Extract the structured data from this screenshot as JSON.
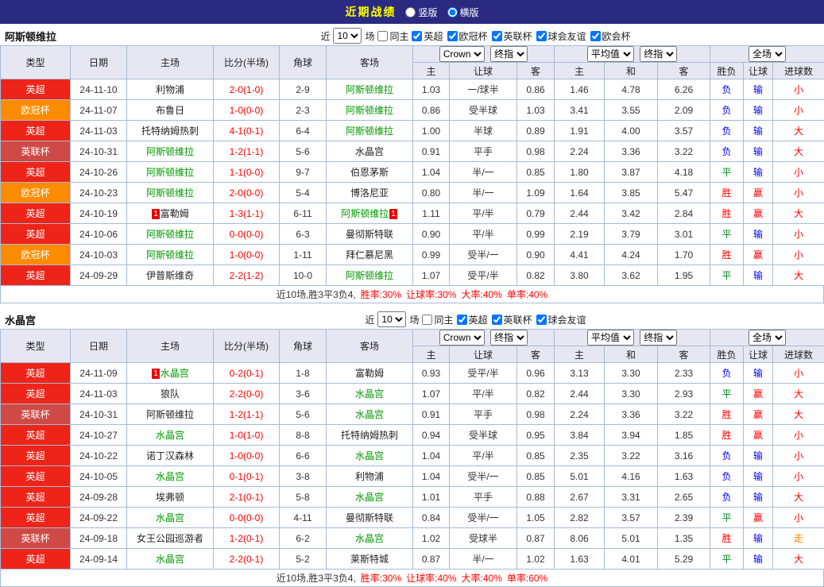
{
  "topbar": {
    "title": "近期战绩",
    "layout_options": [
      {
        "label": "竖版",
        "selected": false
      },
      {
        "label": "横版",
        "selected": true
      }
    ]
  },
  "filter": {
    "prefix": "近",
    "count": "10",
    "suffix": "场",
    "same_home": "同主"
  },
  "table_header": {
    "col_type": "类型",
    "col_date": "日期",
    "col_home": "主场",
    "col_score": "比分(半场)",
    "col_corner": "角球",
    "col_away": "客场",
    "bookmaker_option": "Crown",
    "final_option": "终指",
    "average_option": "平均值",
    "fulltime_option": "全场",
    "sub": [
      "主",
      "让球",
      "客",
      "主",
      "和",
      "客",
      "胜负",
      "让球",
      "进球数"
    ]
  },
  "league_colors": {
    "英超": "#ee2418",
    "欧冠杯": "#ff8c00",
    "英联杯": "#cf4a46"
  },
  "result_colors": {
    "胜": "#ff0000",
    "平": "#008822",
    "负": "#0000ee",
    "赢": "#ff0000",
    "输": "#0000ee",
    "大": "#ff0000",
    "小": "#ff0000",
    "走": "#ff8800"
  },
  "sections": [
    {
      "team": "阿斯顿维拉",
      "leagues": [
        "英超",
        "欧冠杯",
        "英联杯",
        "球会友谊",
        "欧会杯"
      ],
      "rows": [
        {
          "type": "英超",
          "date": "24-11-10",
          "home": {
            "name": "利物浦"
          },
          "score": "2-0(1-0)",
          "corner": "2-9",
          "away": {
            "name": "阿斯顿维拉",
            "subject": true
          },
          "odds": [
            "1.03",
            "一/球半",
            "0.86"
          ],
          "avg": [
            "1.46",
            "4.78",
            "6.26"
          ],
          "results": [
            "负",
            "输",
            "小"
          ]
        },
        {
          "type": "欧冠杯",
          "date": "24-11-07",
          "home": {
            "name": "布鲁日"
          },
          "score": "1-0(0-0)",
          "corner": "2-3",
          "away": {
            "name": "阿斯顿维拉",
            "subject": true
          },
          "odds": [
            "0.86",
            "受半球",
            "1.03"
          ],
          "avg": [
            "3.41",
            "3.55",
            "2.09"
          ],
          "results": [
            "负",
            "输",
            "小"
          ]
        },
        {
          "type": "英超",
          "date": "24-11-03",
          "home": {
            "name": "托特纳姆热刺"
          },
          "score": "4-1(0-1)",
          "corner": "6-4",
          "away": {
            "name": "阿斯顿维拉",
            "subject": true
          },
          "odds": [
            "1.00",
            "半球",
            "0.89"
          ],
          "avg": [
            "1.91",
            "4.00",
            "3.57"
          ],
          "results": [
            "负",
            "输",
            "大"
          ]
        },
        {
          "type": "英联杯",
          "date": "24-10-31",
          "home": {
            "name": "阿斯顿维拉",
            "subject": true
          },
          "score": "1-2(1-1)",
          "corner": "5-6",
          "away": {
            "name": "水晶宫"
          },
          "odds": [
            "0.91",
            "平手",
            "0.98"
          ],
          "avg": [
            "2.24",
            "3.36",
            "3.22"
          ],
          "results": [
            "负",
            "输",
            "大"
          ]
        },
        {
          "type": "英超",
          "date": "24-10-26",
          "home": {
            "name": "阿斯顿维拉",
            "subject": true
          },
          "score": "1-1(0-0)",
          "corner": "9-7",
          "away": {
            "name": "伯恩茅斯"
          },
          "odds": [
            "1.04",
            "半/一",
            "0.85"
          ],
          "avg": [
            "1.80",
            "3.87",
            "4.18"
          ],
          "results": [
            "平",
            "输",
            "小"
          ]
        },
        {
          "type": "欧冠杯",
          "date": "24-10-23",
          "home": {
            "name": "阿斯顿维拉",
            "subject": true
          },
          "score": "2-0(0-0)",
          "corner": "5-4",
          "away": {
            "name": "博洛尼亚"
          },
          "odds": [
            "0.80",
            "半/一",
            "1.09"
          ],
          "avg": [
            "1.64",
            "3.85",
            "5.47"
          ],
          "results": [
            "胜",
            "赢",
            "小"
          ]
        },
        {
          "type": "英超",
          "date": "24-10-19",
          "home": {
            "name": "富勒姆",
            "badge_pre": "1"
          },
          "score": "1-3(1-1)",
          "corner": "6-11",
          "away": {
            "name": "阿斯顿维拉",
            "subject": true,
            "badge_post": "1"
          },
          "odds": [
            "1.11",
            "平/半",
            "0.79"
          ],
          "avg": [
            "2.44",
            "3.42",
            "2.84"
          ],
          "results": [
            "胜",
            "赢",
            "大"
          ]
        },
        {
          "type": "英超",
          "date": "24-10-06",
          "home": {
            "name": "阿斯顿维拉",
            "subject": true
          },
          "score": "0-0(0-0)",
          "corner": "6-3",
          "away": {
            "name": "曼彻斯特联"
          },
          "odds": [
            "0.90",
            "平/半",
            "0.99"
          ],
          "avg": [
            "2.19",
            "3.79",
            "3.01"
          ],
          "results": [
            "平",
            "输",
            "小"
          ]
        },
        {
          "type": "欧冠杯",
          "date": "24-10-03",
          "home": {
            "name": "阿斯顿维拉",
            "subject": true
          },
          "score": "1-0(0-0)",
          "corner": "1-11",
          "away": {
            "name": "拜仁慕尼黑"
          },
          "odds": [
            "0.99",
            "受半/一",
            "0.90"
          ],
          "avg": [
            "4.41",
            "4.24",
            "1.70"
          ],
          "results": [
            "胜",
            "赢",
            "小"
          ]
        },
        {
          "type": "英超",
          "date": "24-09-29",
          "home": {
            "name": "伊普斯维奇"
          },
          "score": "2-2(1-2)",
          "corner": "10-0",
          "away": {
            "name": "阿斯顿维拉",
            "subject": true
          },
          "odds": [
            "1.07",
            "受平/半",
            "0.82"
          ],
          "avg": [
            "3.80",
            "3.62",
            "1.95"
          ],
          "results": [
            "平",
            "输",
            "大"
          ]
        }
      ],
      "summary": [
        {
          "t": "近10场,胜3平3负4,",
          "red": false
        },
        {
          "t": "胜率:30%",
          "red": true
        },
        {
          "t": "让球率:30%",
          "red": true
        },
        {
          "t": "大率:40%",
          "red": true
        },
        {
          "t": "单率:40%",
          "red": true
        }
      ]
    },
    {
      "team": "水晶宫",
      "leagues": [
        "英超",
        "英联杯",
        "球会友谊"
      ],
      "rows": [
        {
          "type": "英超",
          "date": "24-11-09",
          "home": {
            "name": "水晶宫",
            "subject": true,
            "badge_pre": "1"
          },
          "score": "0-2(0-1)",
          "corner": "1-8",
          "away": {
            "name": "富勒姆"
          },
          "odds": [
            "0.93",
            "受平/半",
            "0.96"
          ],
          "avg": [
            "3.13",
            "3.30",
            "2.33"
          ],
          "results": [
            "负",
            "输",
            "小"
          ]
        },
        {
          "type": "英超",
          "date": "24-11-03",
          "home": {
            "name": "狼队"
          },
          "score": "2-2(0-0)",
          "corner": "3-6",
          "away": {
            "name": "水晶宫",
            "subject": true
          },
          "odds": [
            "1.07",
            "平/半",
            "0.82"
          ],
          "avg": [
            "2.44",
            "3.30",
            "2.93"
          ],
          "results": [
            "平",
            "赢",
            "大"
          ]
        },
        {
          "type": "英联杯",
          "date": "24-10-31",
          "home": {
            "name": "阿斯顿维拉"
          },
          "score": "1-2(1-1)",
          "corner": "5-6",
          "away": {
            "name": "水晶宫",
            "subject": true
          },
          "odds": [
            "0.91",
            "平手",
            "0.98"
          ],
          "avg": [
            "2.24",
            "3.36",
            "3.22"
          ],
          "results": [
            "胜",
            "赢",
            "大"
          ]
        },
        {
          "type": "英超",
          "date": "24-10-27",
          "home": {
            "name": "水晶宫",
            "subject": true
          },
          "score": "1-0(1-0)",
          "corner": "8-8",
          "away": {
            "name": "托特纳姆热刺"
          },
          "odds": [
            "0.94",
            "受半球",
            "0.95"
          ],
          "avg": [
            "3.84",
            "3.94",
            "1.85"
          ],
          "results": [
            "胜",
            "赢",
            "小"
          ]
        },
        {
          "type": "英超",
          "date": "24-10-22",
          "home": {
            "name": "诺丁汉森林"
          },
          "score": "1-0(0-0)",
          "corner": "6-6",
          "away": {
            "name": "水晶宫",
            "subject": true
          },
          "odds": [
            "1.04",
            "平/半",
            "0.85"
          ],
          "avg": [
            "2.35",
            "3.22",
            "3.16"
          ],
          "results": [
            "负",
            "输",
            "小"
          ]
        },
        {
          "type": "英超",
          "date": "24-10-05",
          "home": {
            "name": "水晶宫",
            "subject": true
          },
          "score": "0-1(0-1)",
          "corner": "3-8",
          "away": {
            "name": "利物浦"
          },
          "odds": [
            "1.04",
            "受半/一",
            "0.85"
          ],
          "avg": [
            "5.01",
            "4.16",
            "1.63"
          ],
          "results": [
            "负",
            "输",
            "小"
          ]
        },
        {
          "type": "英超",
          "date": "24-09-28",
          "home": {
            "name": "埃弗顿"
          },
          "score": "2-1(0-1)",
          "corner": "5-8",
          "away": {
            "name": "水晶宫",
            "subject": true
          },
          "odds": [
            "1.01",
            "平手",
            "0.88"
          ],
          "avg": [
            "2.67",
            "3.31",
            "2.65"
          ],
          "results": [
            "负",
            "输",
            "大"
          ]
        },
        {
          "type": "英超",
          "date": "24-09-22",
          "home": {
            "name": "水晶宫",
            "subject": true
          },
          "score": "0-0(0-0)",
          "corner": "4-11",
          "away": {
            "name": "曼彻斯特联"
          },
          "odds": [
            "0.84",
            "受半/一",
            "1.05"
          ],
          "avg": [
            "2.82",
            "3.57",
            "2.39"
          ],
          "results": [
            "平",
            "赢",
            "小"
          ]
        },
        {
          "type": "英联杯",
          "date": "24-09-18",
          "home": {
            "name": "女王公园巡游者"
          },
          "score": "1-2(0-1)",
          "corner": "6-2",
          "away": {
            "name": "水晶宫",
            "subject": true
          },
          "odds": [
            "1.02",
            "受球半",
            "0.87"
          ],
          "avg": [
            "8.06",
            "5.01",
            "1.35"
          ],
          "results": [
            "胜",
            "输",
            "走"
          ]
        },
        {
          "type": "英超",
          "date": "24-09-14",
          "home": {
            "name": "水晶宫",
            "subject": true
          },
          "score": "2-2(0-1)",
          "corner": "5-2",
          "away": {
            "name": "莱斯特城"
          },
          "odds": [
            "0.87",
            "半/一",
            "1.02"
          ],
          "avg": [
            "1.63",
            "4.01",
            "5.29"
          ],
          "results": [
            "平",
            "输",
            "大"
          ]
        }
      ],
      "summary": [
        {
          "t": "近10场,胜3平3负4,",
          "red": false
        },
        {
          "t": "胜率:30%",
          "red": true
        },
        {
          "t": "让球率:40%",
          "red": true
        },
        {
          "t": "大率:40%",
          "red": true
        },
        {
          "t": "单率:60%",
          "red": true
        }
      ]
    }
  ]
}
